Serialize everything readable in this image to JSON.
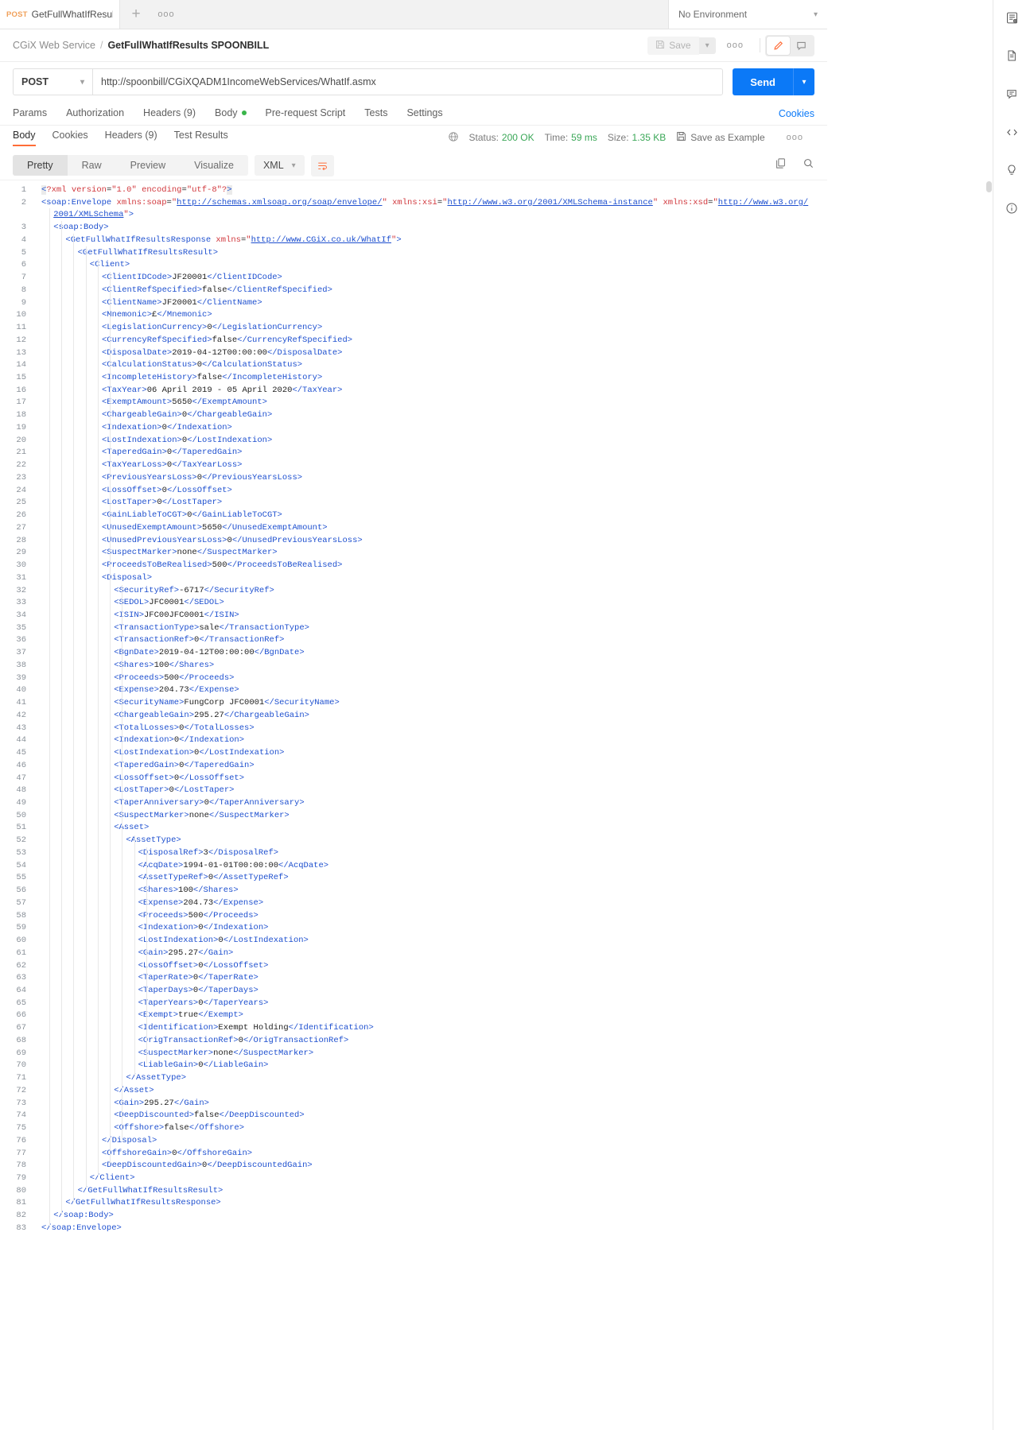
{
  "window": {
    "tab": {
      "method": "POST",
      "name": "GetFullWhatIfResults SP"
    },
    "new_tab_icon": "plus-icon",
    "tab_more_icon": "ellipsis-icon",
    "environment": {
      "label": "No Environment",
      "caret": "chevron-down-icon",
      "eye_icon": "env-quick-look-icon"
    }
  },
  "breadcrumb": {
    "parent": "CGiX Web Service",
    "separator": "/",
    "current": "GetFullWhatIfResults SPOONBILL",
    "save_label": "Save",
    "save_caret": "chevron-down-icon",
    "more": "ooo",
    "edit_icon": "pencil-icon",
    "comment_icon": "comment-icon"
  },
  "request": {
    "method": "POST",
    "method_caret": "chevron-down-icon",
    "url": "http://spoonbill/CGiXQADM1IncomeWebServices/WhatIf.asmx",
    "send_label": "Send",
    "send_caret": "chevron-down-icon",
    "tabs": [
      {
        "label": "Params",
        "dot": false
      },
      {
        "label": "Authorization",
        "dot": false
      },
      {
        "label": "Headers (9)",
        "dot": false
      },
      {
        "label": "Body",
        "dot": true
      },
      {
        "label": "Pre-request Script",
        "dot": false
      },
      {
        "label": "Tests",
        "dot": false
      },
      {
        "label": "Settings",
        "dot": false
      }
    ],
    "cookies_link": "Cookies"
  },
  "response": {
    "tabs": [
      {
        "label": "Body",
        "active": true
      },
      {
        "label": "Cookies",
        "active": false
      },
      {
        "label": "Headers (9)",
        "active": false
      },
      {
        "label": "Test Results",
        "active": false
      }
    ],
    "globe_icon": "globe-icon",
    "status_key": "Status:",
    "status_value": "200 OK",
    "time_key": "Time:",
    "time_value": "59 ms",
    "size_key": "Size:",
    "size_value": "1.35 KB",
    "save_example": "Save as Example",
    "save_example_icon": "floppy-icon",
    "more": "ooo",
    "view_modes": [
      "Pretty",
      "Raw",
      "Preview",
      "Visualize"
    ],
    "active_view_mode": "Pretty",
    "format": "XML",
    "format_caret": "chevron-down-icon",
    "wrap_icon": "wrap-lines-icon",
    "copy_icon": "copy-icon",
    "search_icon": "search-icon"
  },
  "rail": [
    "env-quick-look-icon",
    "documentation-icon",
    "comments-icon",
    "code-snippet-icon",
    "mock-bulb-icon",
    "info-circle-icon"
  ],
  "code_lines": [
    {
      "n": 1,
      "indent": 0,
      "html": "<span class=\"hl brk\">&lt;</span><span class=\"pi\">?xml </span><span class=\"attr\">version</span><span class=\"txt\">=</span><span class=\"str\">\"1.0\"</span><span class=\"txt\"> </span><span class=\"attr\">encoding</span><span class=\"txt\">=</span><span class=\"str\">\"utf-8\"</span><span class=\"pi\">?</span><span class=\"hl brk\">&gt;</span>"
    },
    {
      "n": 2,
      "indent": 0,
      "html": "<span class=\"tag\">&lt;soap:Envelope </span><span class=\"attr\">xmlns:soap</span><span class=\"txt\">=</span><span class=\"str\">\"</span><span class=\"link\">http://schemas.xmlsoap.org/soap/envelope/</span><span class=\"str\">\"</span><span class=\"txt\"> </span><span class=\"attr\">xmlns:xsi</span><span class=\"txt\">=</span><span class=\"str\">\"</span><span class=\"link\">http://www.w3.org/2001/XMLSchema-instance</span><span class=\"str\">\"</span><span class=\"txt\"> </span><span class=\"attr\">xmlns:xsd</span><span class=\"txt\">=</span><span class=\"str\">\"</span><span class=\"link\">http://www.w3.org/</span>"
    },
    {
      "n": null,
      "indent": 0,
      "cont": true,
      "html": "<span class=\"link\">2001/XMLSchema</span><span class=\"str\">\"</span><span class=\"tag\">&gt;</span>"
    },
    {
      "n": 3,
      "indent": 1,
      "html": "<span class=\"tag\">&lt;soap:Body&gt;</span>"
    },
    {
      "n": 4,
      "indent": 2,
      "html": "<span class=\"tag\">&lt;GetFullWhatIfResultsResponse </span><span class=\"attr\">xmlns</span><span class=\"txt\">=</span><span class=\"str\">\"</span><span class=\"link\">http://www.CGiX.co.uk/WhatIf</span><span class=\"str\">\"</span><span class=\"tag\">&gt;</span>"
    },
    {
      "n": 5,
      "indent": 3,
      "html": "<span class=\"tag\">&lt;GetFullWhatIfResultsResult&gt;</span>"
    },
    {
      "n": 6,
      "indent": 4,
      "html": "<span class=\"tag\">&lt;Client&gt;</span>"
    },
    {
      "n": 7,
      "indent": 5,
      "html": "<span class=\"tag\">&lt;ClientIDCode&gt;</span><span class=\"txt\">JF20001</span><span class=\"tag\">&lt;/ClientIDCode&gt;</span>"
    },
    {
      "n": 8,
      "indent": 5,
      "html": "<span class=\"tag\">&lt;ClientRefSpecified&gt;</span><span class=\"txt\">false</span><span class=\"tag\">&lt;/ClientRefSpecified&gt;</span>"
    },
    {
      "n": 9,
      "indent": 5,
      "html": "<span class=\"tag\">&lt;ClientName&gt;</span><span class=\"txt\">JF20001</span><span class=\"tag\">&lt;/ClientName&gt;</span>"
    },
    {
      "n": 10,
      "indent": 5,
      "html": "<span class=\"tag\">&lt;Mnemonic&gt;</span><span class=\"txt\">£</span><span class=\"tag\">&lt;/Mnemonic&gt;</span>"
    },
    {
      "n": 11,
      "indent": 5,
      "html": "<span class=\"tag\">&lt;LegislationCurrency&gt;</span><span class=\"txt\">0</span><span class=\"tag\">&lt;/LegislationCurrency&gt;</span>"
    },
    {
      "n": 12,
      "indent": 5,
      "html": "<span class=\"tag\">&lt;CurrencyRefSpecified&gt;</span><span class=\"txt\">false</span><span class=\"tag\">&lt;/CurrencyRefSpecified&gt;</span>"
    },
    {
      "n": 13,
      "indent": 5,
      "html": "<span class=\"tag\">&lt;DisposalDate&gt;</span><span class=\"txt\">2019-04-12T00:00:00</span><span class=\"tag\">&lt;/DisposalDate&gt;</span>"
    },
    {
      "n": 14,
      "indent": 5,
      "html": "<span class=\"tag\">&lt;CalculationStatus&gt;</span><span class=\"txt\">0</span><span class=\"tag\">&lt;/CalculationStatus&gt;</span>"
    },
    {
      "n": 15,
      "indent": 5,
      "html": "<span class=\"tag\">&lt;IncompleteHistory&gt;</span><span class=\"txt\">false</span><span class=\"tag\">&lt;/IncompleteHistory&gt;</span>"
    },
    {
      "n": 16,
      "indent": 5,
      "html": "<span class=\"tag\">&lt;TaxYear&gt;</span><span class=\"txt\">06 April 2019 - 05 April 2020</span><span class=\"tag\">&lt;/TaxYear&gt;</span>"
    },
    {
      "n": 17,
      "indent": 5,
      "html": "<span class=\"tag\">&lt;ExemptAmount&gt;</span><span class=\"txt\">5650</span><span class=\"tag\">&lt;/ExemptAmount&gt;</span>"
    },
    {
      "n": 18,
      "indent": 5,
      "html": "<span class=\"tag\">&lt;ChargeableGain&gt;</span><span class=\"txt\">0</span><span class=\"tag\">&lt;/ChargeableGain&gt;</span>"
    },
    {
      "n": 19,
      "indent": 5,
      "html": "<span class=\"tag\">&lt;Indexation&gt;</span><span class=\"txt\">0</span><span class=\"tag\">&lt;/Indexation&gt;</span>"
    },
    {
      "n": 20,
      "indent": 5,
      "html": "<span class=\"tag\">&lt;LostIndexation&gt;</span><span class=\"txt\">0</span><span class=\"tag\">&lt;/LostIndexation&gt;</span>"
    },
    {
      "n": 21,
      "indent": 5,
      "html": "<span class=\"tag\">&lt;TaperedGain&gt;</span><span class=\"txt\">0</span><span class=\"tag\">&lt;/TaperedGain&gt;</span>"
    },
    {
      "n": 22,
      "indent": 5,
      "html": "<span class=\"tag\">&lt;TaxYearLoss&gt;</span><span class=\"txt\">0</span><span class=\"tag\">&lt;/TaxYearLoss&gt;</span>"
    },
    {
      "n": 23,
      "indent": 5,
      "html": "<span class=\"tag\">&lt;PreviousYearsLoss&gt;</span><span class=\"txt\">0</span><span class=\"tag\">&lt;/PreviousYearsLoss&gt;</span>"
    },
    {
      "n": 24,
      "indent": 5,
      "html": "<span class=\"tag\">&lt;LossOffset&gt;</span><span class=\"txt\">0</span><span class=\"tag\">&lt;/LossOffset&gt;</span>"
    },
    {
      "n": 25,
      "indent": 5,
      "html": "<span class=\"tag\">&lt;LostTaper&gt;</span><span class=\"txt\">0</span><span class=\"tag\">&lt;/LostTaper&gt;</span>"
    },
    {
      "n": 26,
      "indent": 5,
      "html": "<span class=\"tag\">&lt;GainLiableToCGT&gt;</span><span class=\"txt\">0</span><span class=\"tag\">&lt;/GainLiableToCGT&gt;</span>"
    },
    {
      "n": 27,
      "indent": 5,
      "html": "<span class=\"tag\">&lt;UnusedExemptAmount&gt;</span><span class=\"txt\">5650</span><span class=\"tag\">&lt;/UnusedExemptAmount&gt;</span>"
    },
    {
      "n": 28,
      "indent": 5,
      "html": "<span class=\"tag\">&lt;UnusedPreviousYearsLoss&gt;</span><span class=\"txt\">0</span><span class=\"tag\">&lt;/UnusedPreviousYearsLoss&gt;</span>"
    },
    {
      "n": 29,
      "indent": 5,
      "html": "<span class=\"tag\">&lt;SuspectMarker&gt;</span><span class=\"txt\">none</span><span class=\"tag\">&lt;/SuspectMarker&gt;</span>"
    },
    {
      "n": 30,
      "indent": 5,
      "html": "<span class=\"tag\">&lt;ProceedsToBeRealised&gt;</span><span class=\"txt\">500</span><span class=\"tag\">&lt;/ProceedsToBeRealised&gt;</span>"
    },
    {
      "n": 31,
      "indent": 5,
      "html": "<span class=\"tag\">&lt;Disposal&gt;</span>"
    },
    {
      "n": 32,
      "indent": 6,
      "html": "<span class=\"tag\">&lt;SecurityRef&gt;</span><span class=\"txt\">-6717</span><span class=\"tag\">&lt;/SecurityRef&gt;</span>"
    },
    {
      "n": 33,
      "indent": 6,
      "html": "<span class=\"tag\">&lt;SEDOL&gt;</span><span class=\"txt\">JFC0001</span><span class=\"tag\">&lt;/SEDOL&gt;</span>"
    },
    {
      "n": 34,
      "indent": 6,
      "html": "<span class=\"tag\">&lt;ISIN&gt;</span><span class=\"txt\">JFC00JFC0001</span><span class=\"tag\">&lt;/ISIN&gt;</span>"
    },
    {
      "n": 35,
      "indent": 6,
      "html": "<span class=\"tag\">&lt;TransactionType&gt;</span><span class=\"txt\">sale</span><span class=\"tag\">&lt;/TransactionType&gt;</span>"
    },
    {
      "n": 36,
      "indent": 6,
      "html": "<span class=\"tag\">&lt;TransactionRef&gt;</span><span class=\"txt\">0</span><span class=\"tag\">&lt;/TransactionRef&gt;</span>"
    },
    {
      "n": 37,
      "indent": 6,
      "html": "<span class=\"tag\">&lt;BgnDate&gt;</span><span class=\"txt\">2019-04-12T00:00:00</span><span class=\"tag\">&lt;/BgnDate&gt;</span>"
    },
    {
      "n": 38,
      "indent": 6,
      "html": "<span class=\"tag\">&lt;Shares&gt;</span><span class=\"txt\">100</span><span class=\"tag\">&lt;/Shares&gt;</span>"
    },
    {
      "n": 39,
      "indent": 6,
      "html": "<span class=\"tag\">&lt;Proceeds&gt;</span><span class=\"txt\">500</span><span class=\"tag\">&lt;/Proceeds&gt;</span>"
    },
    {
      "n": 40,
      "indent": 6,
      "html": "<span class=\"tag\">&lt;Expense&gt;</span><span class=\"txt\">204.73</span><span class=\"tag\">&lt;/Expense&gt;</span>"
    },
    {
      "n": 41,
      "indent": 6,
      "html": "<span class=\"tag\">&lt;SecurityName&gt;</span><span class=\"txt\">FungCorp JFC0001</span><span class=\"tag\">&lt;/SecurityName&gt;</span>"
    },
    {
      "n": 42,
      "indent": 6,
      "html": "<span class=\"tag\">&lt;ChargeableGain&gt;</span><span class=\"txt\">295.27</span><span class=\"tag\">&lt;/ChargeableGain&gt;</span>"
    },
    {
      "n": 43,
      "indent": 6,
      "html": "<span class=\"tag\">&lt;TotalLosses&gt;</span><span class=\"txt\">0</span><span class=\"tag\">&lt;/TotalLosses&gt;</span>"
    },
    {
      "n": 44,
      "indent": 6,
      "html": "<span class=\"tag\">&lt;Indexation&gt;</span><span class=\"txt\">0</span><span class=\"tag\">&lt;/Indexation&gt;</span>"
    },
    {
      "n": 45,
      "indent": 6,
      "html": "<span class=\"tag\">&lt;LostIndexation&gt;</span><span class=\"txt\">0</span><span class=\"tag\">&lt;/LostIndexation&gt;</span>"
    },
    {
      "n": 46,
      "indent": 6,
      "html": "<span class=\"tag\">&lt;TaperedGain&gt;</span><span class=\"txt\">0</span><span class=\"tag\">&lt;/TaperedGain&gt;</span>"
    },
    {
      "n": 47,
      "indent": 6,
      "html": "<span class=\"tag\">&lt;LossOffset&gt;</span><span class=\"txt\">0</span><span class=\"tag\">&lt;/LossOffset&gt;</span>"
    },
    {
      "n": 48,
      "indent": 6,
      "html": "<span class=\"tag\">&lt;LostTaper&gt;</span><span class=\"txt\">0</span><span class=\"tag\">&lt;/LostTaper&gt;</span>"
    },
    {
      "n": 49,
      "indent": 6,
      "html": "<span class=\"tag\">&lt;TaperAnniversary&gt;</span><span class=\"txt\">0</span><span class=\"tag\">&lt;/TaperAnniversary&gt;</span>"
    },
    {
      "n": 50,
      "indent": 6,
      "html": "<span class=\"tag\">&lt;SuspectMarker&gt;</span><span class=\"txt\">none</span><span class=\"tag\">&lt;/SuspectMarker&gt;</span>"
    },
    {
      "n": 51,
      "indent": 6,
      "html": "<span class=\"tag\">&lt;Asset&gt;</span>"
    },
    {
      "n": 52,
      "indent": 7,
      "html": "<span class=\"tag\">&lt;AssetType&gt;</span>"
    },
    {
      "n": 53,
      "indent": 8,
      "html": "<span class=\"tag\">&lt;DisposalRef&gt;</span><span class=\"txt\">3</span><span class=\"tag\">&lt;/DisposalRef&gt;</span>"
    },
    {
      "n": 54,
      "indent": 8,
      "html": "<span class=\"tag\">&lt;AcqDate&gt;</span><span class=\"txt\">1994-01-01T00:00:00</span><span class=\"tag\">&lt;/AcqDate&gt;</span>"
    },
    {
      "n": 55,
      "indent": 8,
      "html": "<span class=\"tag\">&lt;AssetTypeRef&gt;</span><span class=\"txt\">0</span><span class=\"tag\">&lt;/AssetTypeRef&gt;</span>"
    },
    {
      "n": 56,
      "indent": 8,
      "html": "<span class=\"tag\">&lt;Shares&gt;</span><span class=\"txt\">100</span><span class=\"tag\">&lt;/Shares&gt;</span>"
    },
    {
      "n": 57,
      "indent": 8,
      "html": "<span class=\"tag\">&lt;Expense&gt;</span><span class=\"txt\">204.73</span><span class=\"tag\">&lt;/Expense&gt;</span>"
    },
    {
      "n": 58,
      "indent": 8,
      "html": "<span class=\"tag\">&lt;Proceeds&gt;</span><span class=\"txt\">500</span><span class=\"tag\">&lt;/Proceeds&gt;</span>"
    },
    {
      "n": 59,
      "indent": 8,
      "html": "<span class=\"tag\">&lt;Indexation&gt;</span><span class=\"txt\">0</span><span class=\"tag\">&lt;/Indexation&gt;</span>"
    },
    {
      "n": 60,
      "indent": 8,
      "html": "<span class=\"tag\">&lt;LostIndexation&gt;</span><span class=\"txt\">0</span><span class=\"tag\">&lt;/LostIndexation&gt;</span>"
    },
    {
      "n": 61,
      "indent": 8,
      "html": "<span class=\"tag\">&lt;Gain&gt;</span><span class=\"txt\">295.27</span><span class=\"tag\">&lt;/Gain&gt;</span>"
    },
    {
      "n": 62,
      "indent": 8,
      "html": "<span class=\"tag\">&lt;LossOffset&gt;</span><span class=\"txt\">0</span><span class=\"tag\">&lt;/LossOffset&gt;</span>"
    },
    {
      "n": 63,
      "indent": 8,
      "html": "<span class=\"tag\">&lt;TaperRate&gt;</span><span class=\"txt\">0</span><span class=\"tag\">&lt;/TaperRate&gt;</span>"
    },
    {
      "n": 64,
      "indent": 8,
      "html": "<span class=\"tag\">&lt;TaperDays&gt;</span><span class=\"txt\">0</span><span class=\"tag\">&lt;/TaperDays&gt;</span>"
    },
    {
      "n": 65,
      "indent": 8,
      "html": "<span class=\"tag\">&lt;TaperYears&gt;</span><span class=\"txt\">0</span><span class=\"tag\">&lt;/TaperYears&gt;</span>"
    },
    {
      "n": 66,
      "indent": 8,
      "html": "<span class=\"tag\">&lt;Exempt&gt;</span><span class=\"txt\">true</span><span class=\"tag\">&lt;/Exempt&gt;</span>"
    },
    {
      "n": 67,
      "indent": 8,
      "html": "<span class=\"tag\">&lt;Identification&gt;</span><span class=\"txt\">Exempt Holding</span><span class=\"tag\">&lt;/Identification&gt;</span>"
    },
    {
      "n": 68,
      "indent": 8,
      "html": "<span class=\"tag\">&lt;OrigTransactionRef&gt;</span><span class=\"txt\">0</span><span class=\"tag\">&lt;/OrigTransactionRef&gt;</span>"
    },
    {
      "n": 69,
      "indent": 8,
      "html": "<span class=\"tag\">&lt;SuspectMarker&gt;</span><span class=\"txt\">none</span><span class=\"tag\">&lt;/SuspectMarker&gt;</span>"
    },
    {
      "n": 70,
      "indent": 8,
      "html": "<span class=\"tag\">&lt;LiableGain&gt;</span><span class=\"txt\">0</span><span class=\"tag\">&lt;/LiableGain&gt;</span>"
    },
    {
      "n": 71,
      "indent": 7,
      "html": "<span class=\"tag\">&lt;/AssetType&gt;</span>"
    },
    {
      "n": 72,
      "indent": 6,
      "html": "<span class=\"tag\">&lt;/Asset&gt;</span>"
    },
    {
      "n": 73,
      "indent": 6,
      "html": "<span class=\"tag\">&lt;Gain&gt;</span><span class=\"txt\">295.27</span><span class=\"tag\">&lt;/Gain&gt;</span>"
    },
    {
      "n": 74,
      "indent": 6,
      "html": "<span class=\"tag\">&lt;DeepDiscounted&gt;</span><span class=\"txt\">false</span><span class=\"tag\">&lt;/DeepDiscounted&gt;</span>"
    },
    {
      "n": 75,
      "indent": 6,
      "html": "<span class=\"tag\">&lt;Offshore&gt;</span><span class=\"txt\">false</span><span class=\"tag\">&lt;/Offshore&gt;</span>"
    },
    {
      "n": 76,
      "indent": 5,
      "html": "<span class=\"tag\">&lt;/Disposal&gt;</span>"
    },
    {
      "n": 77,
      "indent": 5,
      "html": "<span class=\"tag\">&lt;OffshoreGain&gt;</span><span class=\"txt\">0</span><span class=\"tag\">&lt;/OffshoreGain&gt;</span>"
    },
    {
      "n": 78,
      "indent": 5,
      "html": "<span class=\"tag\">&lt;DeepDiscountedGain&gt;</span><span class=\"txt\">0</span><span class=\"tag\">&lt;/DeepDiscountedGain&gt;</span>"
    },
    {
      "n": 79,
      "indent": 4,
      "html": "<span class=\"tag\">&lt;/Client&gt;</span>"
    },
    {
      "n": 80,
      "indent": 3,
      "html": "<span class=\"tag\">&lt;/GetFullWhatIfResultsResult&gt;</span>"
    },
    {
      "n": 81,
      "indent": 2,
      "html": "<span class=\"tag\">&lt;/GetFullWhatIfResultsResponse&gt;</span>"
    },
    {
      "n": 82,
      "indent": 1,
      "html": "<span class=\"tag\">&lt;/soap:Body&gt;</span>"
    },
    {
      "n": 83,
      "indent": 0,
      "html": "<span class=\"tag\">&lt;/soap:Envelope&gt;</span>"
    }
  ]
}
